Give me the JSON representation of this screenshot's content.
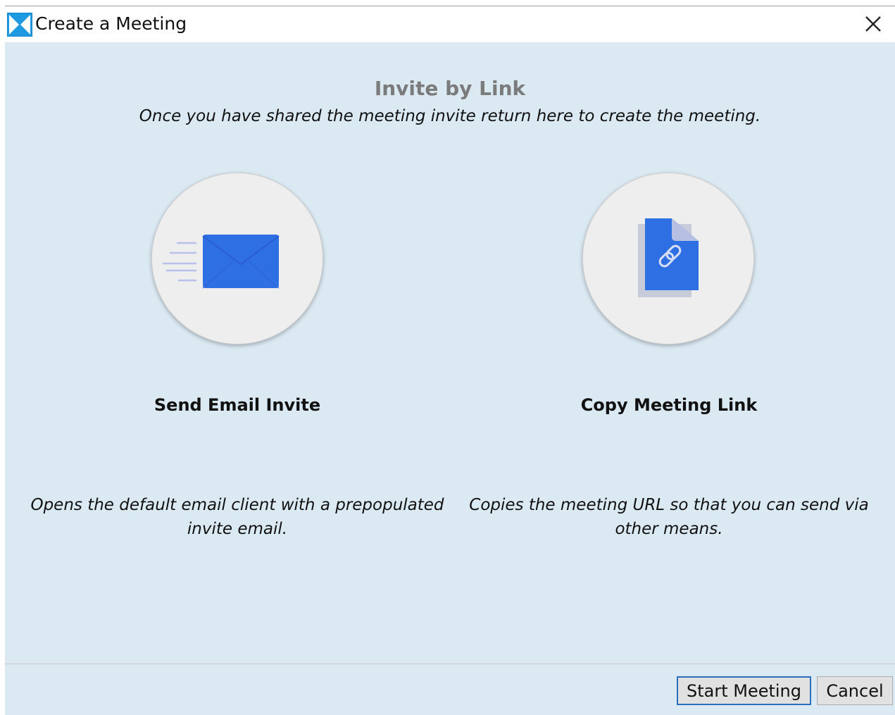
{
  "window": {
    "title": "Create a Meeting",
    "app_icon": "app-logo-icon",
    "close_icon": "close-icon"
  },
  "main": {
    "heading": "Invite by Link",
    "subheading": "Once you have shared the meeting invite return here to create the meeting.",
    "options": [
      {
        "icon": "email-envelope-icon",
        "title": "Send Email Invite",
        "description": "Opens the default email client with a prepopulated invite email."
      },
      {
        "icon": "link-document-icon",
        "title": "Copy Meeting Link",
        "description": "Copies the meeting URL so that you can send via other means."
      }
    ]
  },
  "footer": {
    "start_label": "Start Meeting",
    "cancel_label": "Cancel"
  },
  "colors": {
    "accent_blue": "#2f6fe4",
    "content_bg": "#dbe9f3",
    "heading_gray": "#7b7b7b",
    "button_focus_border": "#2a6ebd"
  }
}
